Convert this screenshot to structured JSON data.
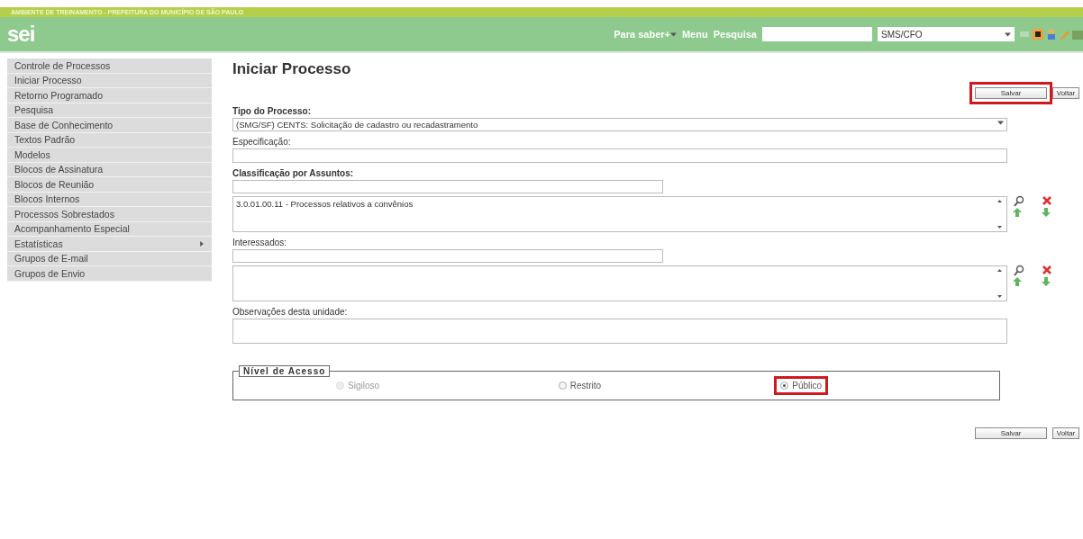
{
  "header": {
    "environment": "AMBIENTE DE TREINAMENTO - PREFEITURA DO MUNICÍPIO DE SÃO PAULO",
    "logo": "sei",
    "menu": [
      {
        "label": "Para saber+",
        "dropdown": true
      },
      {
        "label": "Menu",
        "dropdown": false
      },
      {
        "label": "Pesquisa",
        "dropdown": false
      }
    ],
    "unit_select": {
      "value": "SMS/CFO"
    }
  },
  "sidebar": {
    "items": [
      {
        "label": "Controle de Processos",
        "submenu": false
      },
      {
        "label": "Iniciar Processo",
        "submenu": false
      },
      {
        "label": "Retorno Programado",
        "submenu": false
      },
      {
        "label": "Pesquisa",
        "submenu": false
      },
      {
        "label": "Base de Conhecimento",
        "submenu": false
      },
      {
        "label": "Textos Padrão",
        "submenu": false
      },
      {
        "label": "Modelos",
        "submenu": false
      },
      {
        "label": "Blocos de Assinatura",
        "submenu": false
      },
      {
        "label": "Blocos de Reunião",
        "submenu": false
      },
      {
        "label": "Blocos Internos",
        "submenu": false
      },
      {
        "label": "Processos Sobrestados",
        "submenu": false
      },
      {
        "label": "Acompanhamento Especial",
        "submenu": false
      },
      {
        "label": "Estatísticas",
        "submenu": true
      },
      {
        "label": "Grupos de E-mail",
        "submenu": false
      },
      {
        "label": "Grupos de Envio",
        "submenu": false
      }
    ]
  },
  "page": {
    "title": "Iniciar Processo",
    "top_buttons": [
      {
        "label": "Salvar",
        "highlighted": true
      },
      {
        "label": "Voltar",
        "highlighted": false
      }
    ],
    "fields": [
      {
        "kind": "select",
        "label": "Tipo do Processo:",
        "required": true,
        "value": "(SMG/SF) CENTS: Solicitação de cadastro ou recadastramento"
      },
      {
        "kind": "input",
        "label": "Especificação:",
        "required": false
      },
      {
        "kind": "picker",
        "label": "Classificação por Assuntos:",
        "required": true,
        "list": [
          "3.0.01.00.11 - Processos relativos a convênios"
        ]
      },
      {
        "kind": "picker",
        "label": "Interessados:",
        "required": false
      },
      {
        "kind": "textarea",
        "label": "Observações desta unidade:",
        "required": false
      }
    ],
    "access_level": {
      "legend": "Nível de Acesso",
      "options": [
        {
          "label": "Sigiloso",
          "selected": false,
          "disabled": true,
          "highlighted": false
        },
        {
          "label": "Restrito",
          "selected": false,
          "disabled": false,
          "highlighted": false
        },
        {
          "label": "Público",
          "selected": true,
          "disabled": false,
          "highlighted": true
        }
      ]
    },
    "bottom_buttons": [
      {
        "label": "Salvar",
        "highlighted": false
      },
      {
        "label": "Voltar",
        "highlighted": false
      }
    ]
  }
}
